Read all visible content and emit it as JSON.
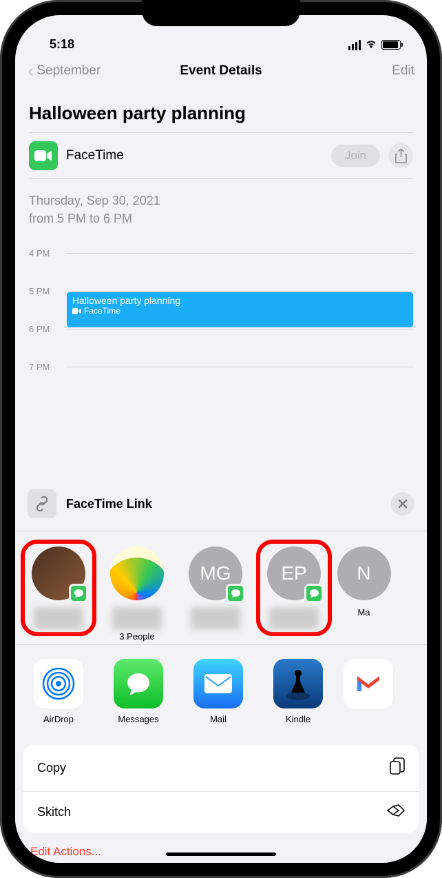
{
  "status": {
    "time": "5:18"
  },
  "nav": {
    "back": "September",
    "title": "Event Details",
    "edit": "Edit"
  },
  "event": {
    "title": "Halloween party planning",
    "facetime_label": "FaceTime",
    "join_label": "Join",
    "date_line1": "Thursday, Sep 30, 2021",
    "date_line2": "from 5 PM to 6 PM"
  },
  "timeline": {
    "slots": [
      "4 PM",
      "5 PM",
      "6 PM",
      "7 PM"
    ],
    "block_title": "Halloween party planning",
    "block_sub": "FaceTime"
  },
  "sheet": {
    "title": "FaceTime Link",
    "contacts": [
      {
        "initials": "",
        "label": "",
        "type": "photo",
        "highlight": true
      },
      {
        "initials": "",
        "label": "3 People",
        "type": "rainbow",
        "highlight": false
      },
      {
        "initials": "MG",
        "label": "",
        "type": "initials",
        "highlight": false
      },
      {
        "initials": "EP",
        "label": "",
        "type": "initials",
        "highlight": true
      },
      {
        "initials": "N",
        "label": "Ma",
        "type": "initials",
        "highlight": false
      }
    ],
    "apps": [
      {
        "name": "AirDrop"
      },
      {
        "name": "Messages"
      },
      {
        "name": "Mail"
      },
      {
        "name": "Kindle"
      },
      {
        "name": ""
      }
    ],
    "actions": {
      "copy": "Copy",
      "skitch": "Skitch",
      "edit": "Edit Actions..."
    }
  }
}
